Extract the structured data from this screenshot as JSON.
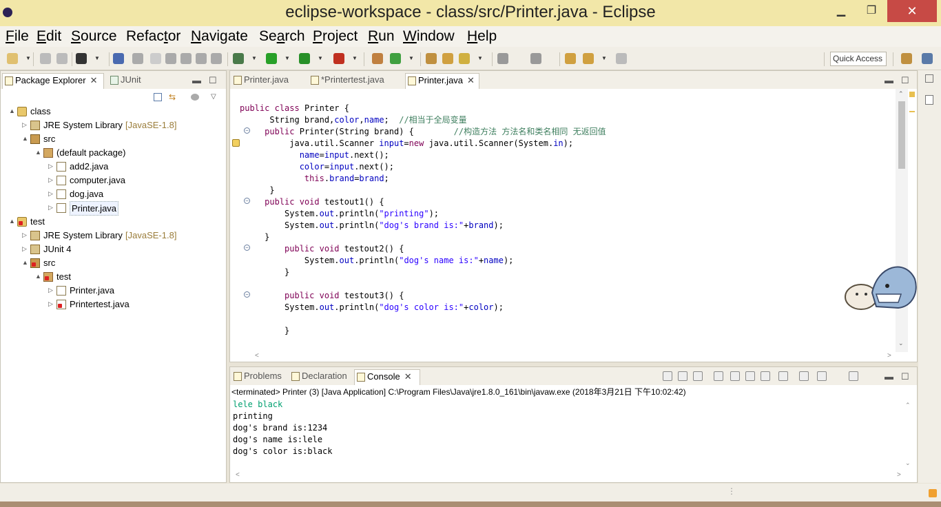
{
  "window": {
    "title": "eclipse-workspace - class/src/Printer.java - Eclipse",
    "min": "▁",
    "max": "❐",
    "close": "✕"
  },
  "menu": [
    {
      "u": "F",
      "rest": "ile"
    },
    {
      "u": "E",
      "rest": "dit"
    },
    {
      "u": "S",
      "rest": "ource"
    },
    {
      "u": "",
      "pre": "Refac",
      "u2": "t",
      "rest": "or"
    },
    {
      "u": "N",
      "rest": "avigate"
    },
    {
      "u": "",
      "pre": "Se",
      "u2": "a",
      "rest": "rch"
    },
    {
      "u": "P",
      "rest": "roject"
    },
    {
      "u": "R",
      "rest": "un"
    },
    {
      "u": "W",
      "rest": "indow"
    },
    {
      "u": "H",
      "rest": "elp"
    }
  ],
  "quick_access": "Quick Access",
  "package_explorer": {
    "tabs": [
      "Package Explorer",
      "JUnit"
    ],
    "tree": [
      {
        "label": "class",
        "indent": 0,
        "twisty": "▲",
        "icon": "project-icon",
        "kind": "proj"
      },
      {
        "label": "JRE System Library",
        "decor": "[JavaSE-1.8]",
        "indent": 1,
        "twisty": "▷",
        "icon": "library-icon",
        "kind": "lib"
      },
      {
        "label": "src",
        "indent": 1,
        "twisty": "▲",
        "icon": "source-folder-icon",
        "kind": "src"
      },
      {
        "label": "(default package)",
        "indent": 2,
        "twisty": "▲",
        "icon": "package-icon",
        "kind": "pkg"
      },
      {
        "label": "add2.java",
        "indent": 3,
        "twisty": "▷",
        "icon": "java-file-icon",
        "kind": "file"
      },
      {
        "label": "computer.java",
        "indent": 3,
        "twisty": "▷",
        "icon": "java-file-icon",
        "kind": "file"
      },
      {
        "label": "dog.java",
        "indent": 3,
        "twisty": "▷",
        "icon": "java-file-icon",
        "kind": "file"
      },
      {
        "label": "Printer.java",
        "indent": 3,
        "twisty": "▷",
        "icon": "java-file-icon",
        "kind": "file",
        "selected": true
      },
      {
        "label": "test",
        "indent": 0,
        "twisty": "▲",
        "icon": "project-error-icon",
        "kind": "proj err"
      },
      {
        "label": "JRE System Library",
        "decor": "[JavaSE-1.8]",
        "indent": 1,
        "twisty": "▷",
        "icon": "library-icon",
        "kind": "lib"
      },
      {
        "label": "JUnit 4",
        "indent": 1,
        "twisty": "▷",
        "icon": "library-icon",
        "kind": "lib"
      },
      {
        "label": "src",
        "indent": 1,
        "twisty": "▲",
        "icon": "source-folder-error-icon",
        "kind": "src err"
      },
      {
        "label": "test",
        "indent": 2,
        "twisty": "▲",
        "icon": "package-error-icon",
        "kind": "pkg err"
      },
      {
        "label": "Printer.java",
        "indent": 3,
        "twisty": "▷",
        "icon": "java-file-icon",
        "kind": "file"
      },
      {
        "label": "Printertest.java",
        "indent": 3,
        "twisty": "▷",
        "icon": "java-file-error-icon",
        "kind": "file err"
      }
    ]
  },
  "editor": {
    "tabs": [
      {
        "label": "Printer.java",
        "active": false
      },
      {
        "label": "*Printertest.java",
        "active": false
      },
      {
        "label": "Printer.java",
        "active": true
      }
    ],
    "code": [
      "",
      "public class Printer {",
      "      String brand,color,name;  //相当于全局变量",
      "     public Printer(String brand) {        //构造方法 方法名和类名相同 无返回值",
      "          java.util.Scanner input=new java.util.Scanner(System.in);",
      "            name=input.next();",
      "            color=input.next();",
      "             this.brand=brand;",
      "      }",
      "     public void testout1() {",
      "         System.out.println(\"printing\");",
      "         System.out.println(\"dog's brand is:\"+brand);",
      "     }",
      "         public void testout2() {",
      "             System.out.println(\"dog's name is:\"+name);",
      "         }",
      "",
      "         public void testout3() {",
      "         System.out.println(\"dog's color is:\"+color);",
      "",
      "         }"
    ]
  },
  "bottom": {
    "tabs": [
      {
        "label": "Problems",
        "active": false
      },
      {
        "label": "Declaration",
        "active": false
      },
      {
        "label": "Console",
        "active": true
      }
    ],
    "status": "<terminated> Printer (3) [Java Application] C:\\Program Files\\Java\\jre1.8.0_161\\bin\\javaw.exe (2018年3月21日 下午10:02:42)",
    "output": [
      {
        "text": "lele black",
        "input": true
      },
      {
        "text": "printing",
        "input": false
      },
      {
        "text": "dog's brand is:1234",
        "input": false
      },
      {
        "text": "dog's name is:lele",
        "input": false
      },
      {
        "text": "dog's color is:black",
        "input": false
      }
    ]
  },
  "colors": {
    "title_bar": "#f2e7a8",
    "close_button": "#c74a45",
    "keyword": "#7f0055",
    "field": "#0000c0",
    "string": "#2a00ff",
    "comment": "#3f7f5f",
    "console_input": "#00a070"
  }
}
